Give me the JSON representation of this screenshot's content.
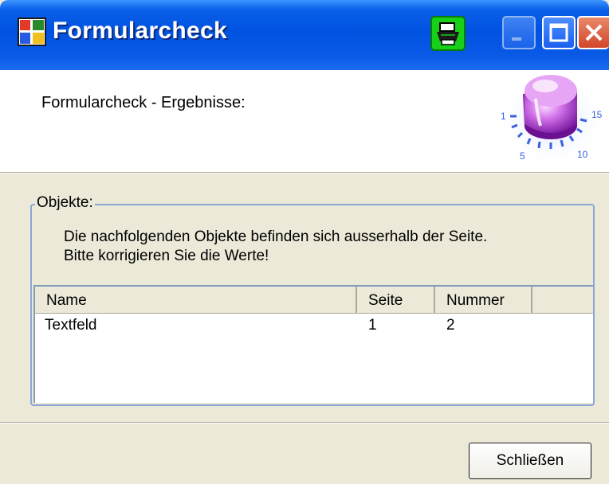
{
  "window": {
    "title": "Formularcheck",
    "app_icon": "form-window-icon",
    "print_icon": "printer-icon"
  },
  "header": {
    "text": "Formularcheck - Ergebnisse:",
    "knob_scale": [
      "1",
      "5",
      "10",
      "15"
    ]
  },
  "group": {
    "legend": "Objekte:",
    "info_line1": "Die nachfolgenden Objekte befinden sich ausserhalb der Seite.",
    "info_line2": "Bitte korrigieren Sie die Werte!"
  },
  "table": {
    "columns": [
      "Name",
      "Seite",
      "Nummer"
    ],
    "rows": [
      {
        "name": "Textfeld",
        "seite": "1",
        "nummer": "2"
      }
    ]
  },
  "footer": {
    "close_label": "Schließen"
  },
  "colors": {
    "titlebar": "#0052e0",
    "print_button": "#18d018",
    "knob": "#d06fe8",
    "dialog_bg": "#ece9d8"
  }
}
